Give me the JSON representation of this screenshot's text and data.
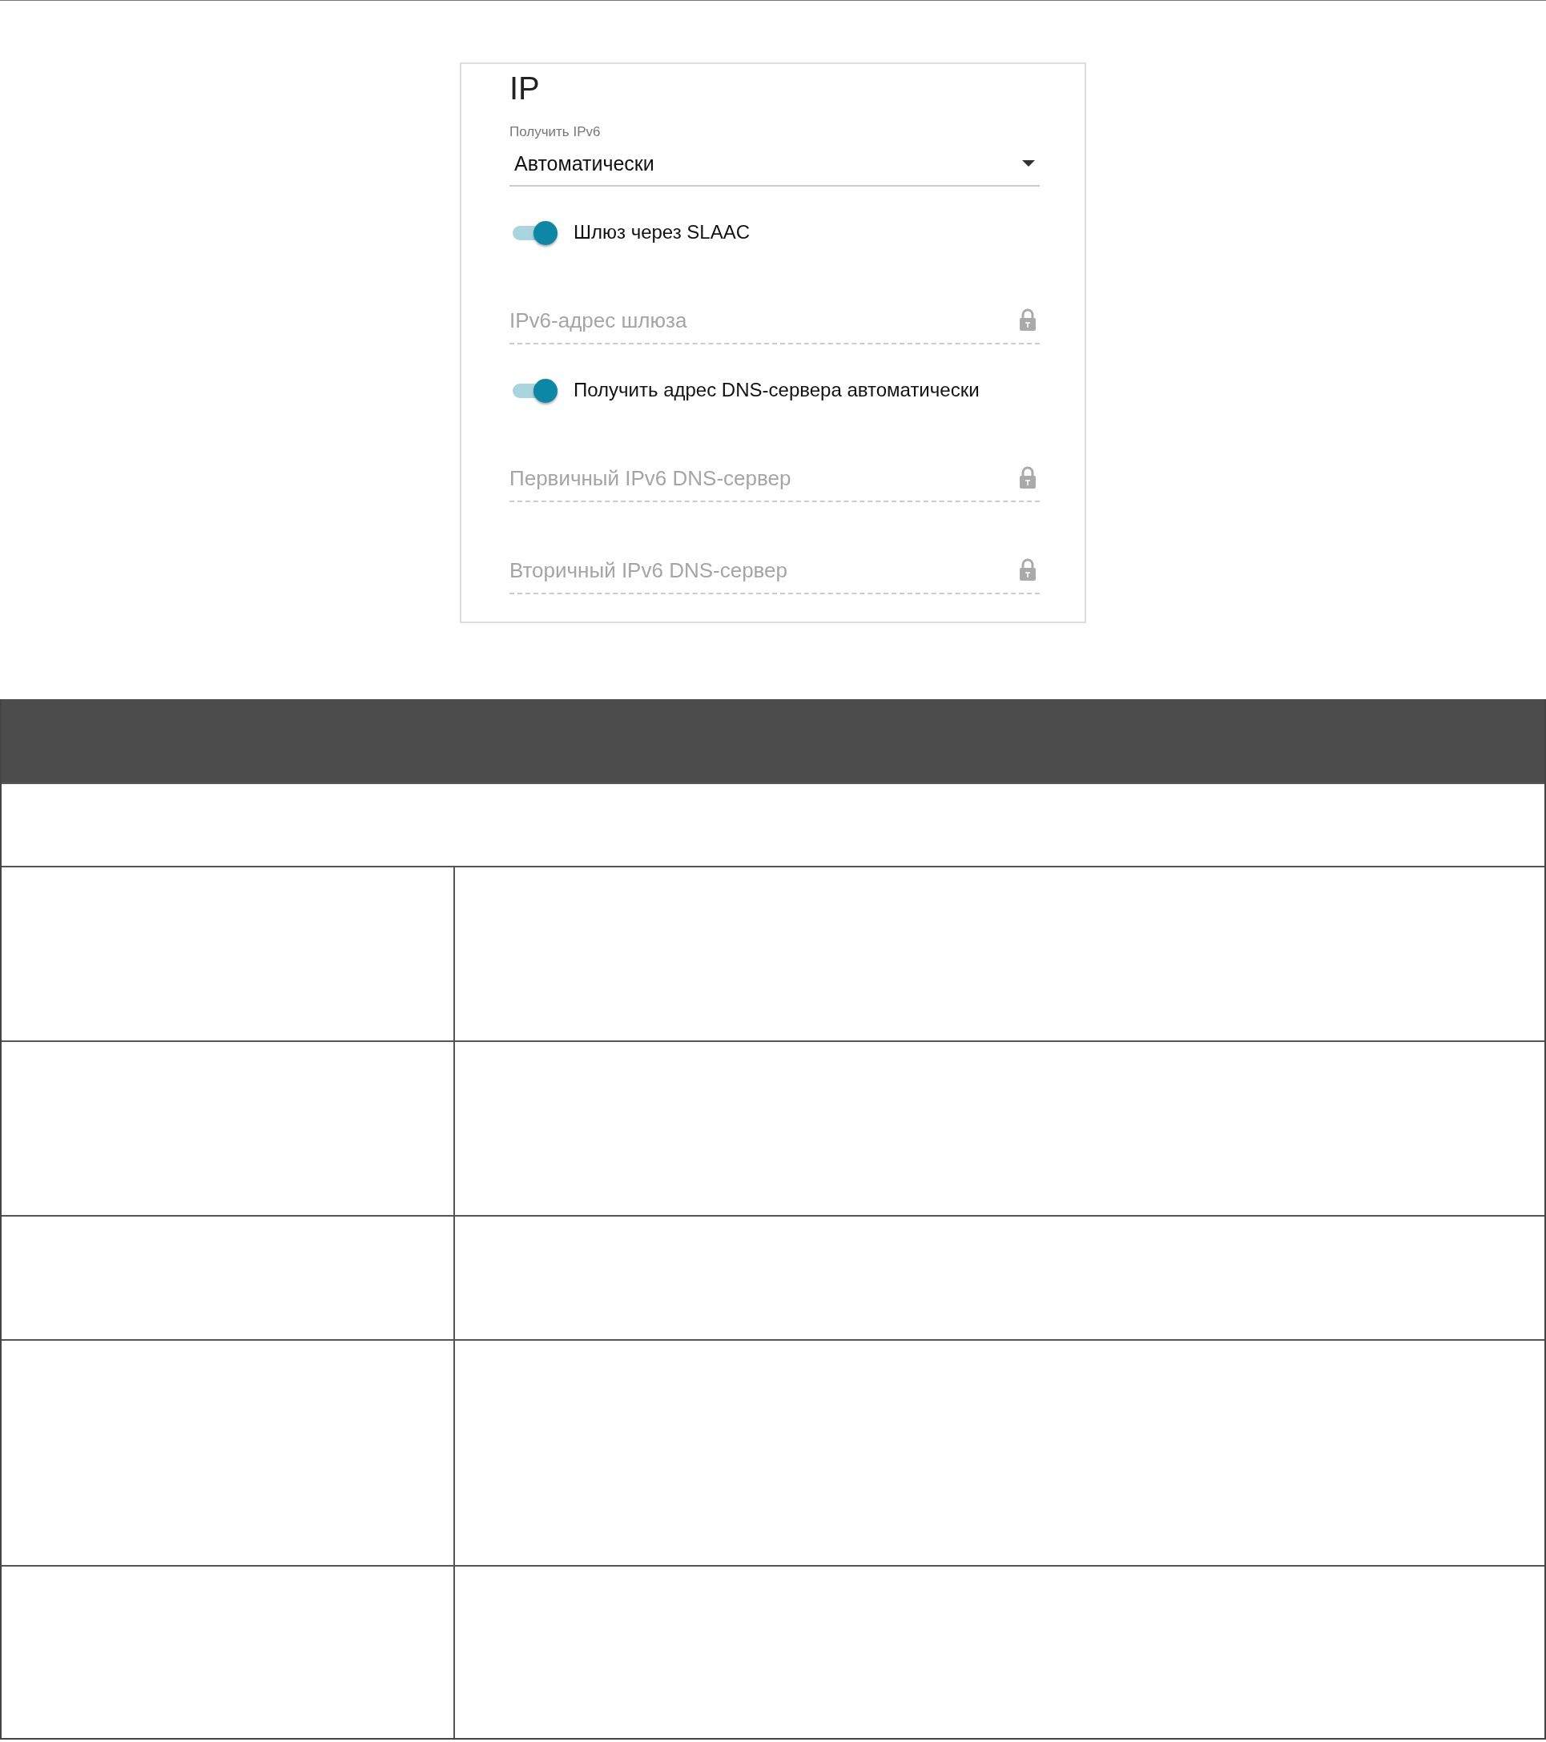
{
  "panel": {
    "title": "IP",
    "select": {
      "label": "Получить IPv6",
      "value": "Автоматически"
    },
    "items": [
      {
        "kind": "toggle",
        "label": "Шлюз через SLAAC",
        "on": true
      },
      {
        "kind": "field",
        "placeholder": "IPv6-адрес шлюза",
        "locked": true
      },
      {
        "kind": "toggle",
        "label": "Получить адрес DNS-сервера автоматически",
        "on": true
      },
      {
        "kind": "field",
        "placeholder": "Первичный IPv6 DNS-сервер",
        "locked": true
      },
      {
        "kind": "field",
        "placeholder": "Вторичный IPv6 DNS-сервер",
        "locked": true
      }
    ]
  }
}
